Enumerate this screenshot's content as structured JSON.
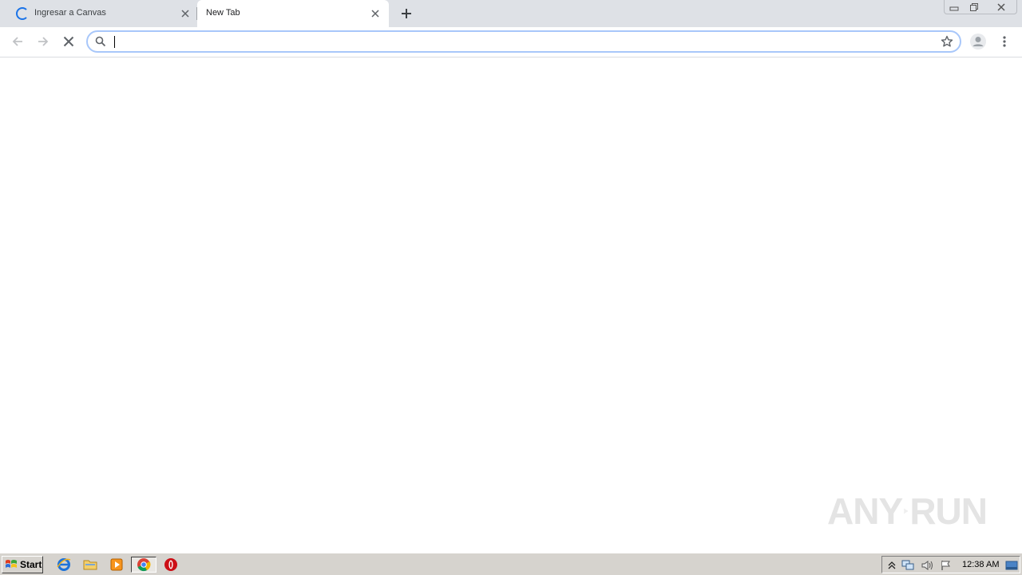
{
  "browser": {
    "tabs": [
      {
        "title": "Ingresar a Canvas",
        "loading": true,
        "active": false
      },
      {
        "title": "New Tab",
        "loading": false,
        "active": true
      }
    ],
    "omnibox": {
      "value": "",
      "placeholder": ""
    }
  },
  "watermark": {
    "text_left": "ANY",
    "text_right": "RUN"
  },
  "taskbar": {
    "start_label": "Start",
    "clock": "12:38 AM",
    "quick_launch": [
      "internet-explorer-icon",
      "folder-icon",
      "media-player-icon",
      "chrome-icon",
      "opera-icon"
    ]
  },
  "colors": {
    "tabstrip": "#dee1e6",
    "omnibox_focus": "#a8c7fa",
    "spinner": "#1a73e8",
    "taskbar": "#d6d3ce"
  }
}
